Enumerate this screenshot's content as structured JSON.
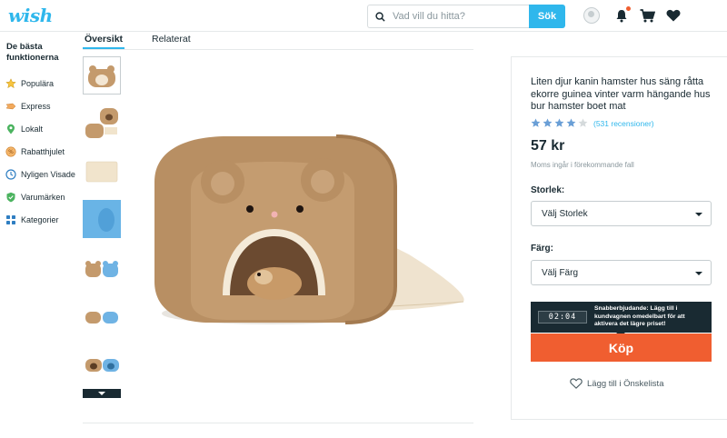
{
  "header": {
    "logo": "wish",
    "search_placeholder": "Vad vill du hitta?",
    "search_button": "Sök",
    "icons": [
      "avatar",
      "bell-icon",
      "cart-icon",
      "heart-icon"
    ],
    "accent": "#2fb7ec"
  },
  "sidebar": {
    "title": "De bästa funktionerna",
    "items": [
      {
        "label": "Populära",
        "icon": "star-icon"
      },
      {
        "label": "Express",
        "icon": "express-icon"
      },
      {
        "label": "Lokalt",
        "icon": "location-pin-icon"
      },
      {
        "label": "Rabatthjulet",
        "icon": "coupon-wheel-icon"
      },
      {
        "label": "Nyligen Visade",
        "icon": "clock-icon"
      },
      {
        "label": "Varumärken",
        "icon": "shield-check-icon"
      },
      {
        "label": "Kategorier",
        "icon": "grid-icon"
      }
    ]
  },
  "tabs": [
    {
      "label": "Översikt",
      "active": true
    },
    {
      "label": "Relaterat",
      "active": false
    }
  ],
  "product": {
    "title": "Liten djur kanin hamster hus säng råtta ekorre guinea vinter varm hängande hus bur hamster boet mat",
    "rating_stars": 4,
    "rating_max": 5,
    "reviews": "(531 recensioner)",
    "price": "57 kr",
    "tax_note": "Moms ingår i förekommande fall",
    "size_label": "Storlek:",
    "size_select": "Välj Storlek",
    "color_label": "Färg:",
    "color_select": "Välj Färg",
    "timer": "02:04",
    "promo_text": "Snabberbjudande: Lägg till i kundvagnen omedelbart för att aktivera det lägre priset!",
    "buy_button": "Köp",
    "wishlist": "Lägg till i Önskelista",
    "buy_color": "#f05e30"
  }
}
